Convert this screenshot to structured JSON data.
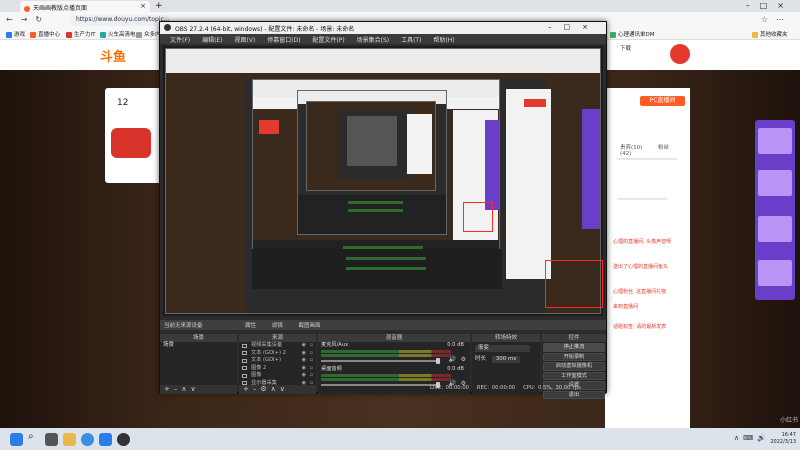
{
  "browser": {
    "tab_title": "天画画教版点播页面",
    "url": "https://www.douyu.com/topic...",
    "nav_icons": [
      "back-icon",
      "forward-icon",
      "refresh-icon"
    ],
    "favorites": [
      "游戏",
      "直播中心",
      "生产力IT",
      "火车高清电",
      "心情通",
      "众多内容",
      "心理通讯单DM"
    ],
    "favorites_right": "其他收藏夹"
  },
  "site": {
    "logo": "斗鱼",
    "header_icons": [
      "下载",
      "心理中心"
    ],
    "room_count": "12",
    "pc_button": "PC直播间",
    "right_tabs": [
      "贵宾(10)",
      "粉丝(42)"
    ],
    "chat_lines": [
      "心理的直播间, 头像声音呀",
      "送出了心理的直播间鱼丸",
      "心理粉丝, 这直播间礼物",
      "来到直播间",
      "话题标签: 请的最新发表"
    ],
    "promo_labels": [
      "好戏上场",
      "活动专属礼"
    ]
  },
  "obs": {
    "title": "OBS 27.2.4 (64-bit, windows) - 配置文件: 未命名 - 场景: 未命名",
    "menu": [
      "文件(F)",
      "编辑(E)",
      "视图(V)",
      "停靠窗口(D)",
      "配置文件(P)",
      "场景集合(S)",
      "工具(T)",
      "帮助(H)"
    ],
    "docks_header": {
      "left": "当前无来源设备",
      "tabs": [
        "属性",
        "滤镜",
        "截图画面"
      ]
    },
    "scenes": {
      "header": "场景",
      "items": [
        "场景"
      ]
    },
    "sources": {
      "header": "来源",
      "items": [
        "视频采集设备",
        "文本 (GDI+) 2",
        "文本 (GDI+)",
        "图像 2",
        "图像",
        "显示器采集"
      ]
    },
    "mixer": {
      "header": "混音器",
      "channels": [
        {
          "name": "麦克风/Aux",
          "db": "0.0 dB"
        },
        {
          "name": "桌面音频",
          "db": "0.0 dB"
        }
      ]
    },
    "transitions": {
      "header": "转场特效",
      "type": "渐变",
      "duration_label": "时长",
      "duration": "300 ms"
    },
    "controls": {
      "header": "控件",
      "buttons": [
        "停止推流",
        "开始录制",
        "启动虚拟摄像机",
        "工作室模式",
        "设置",
        "退出"
      ]
    },
    "status": {
      "live": "LIVE: 00:00:00",
      "rec": "REC: 00:00:00",
      "cpu": "CPU: 0.5%, 30.00 fps"
    }
  },
  "taskbar": {
    "time": "16:47",
    "date": "2022/3/13"
  },
  "watermark": "小红书"
}
